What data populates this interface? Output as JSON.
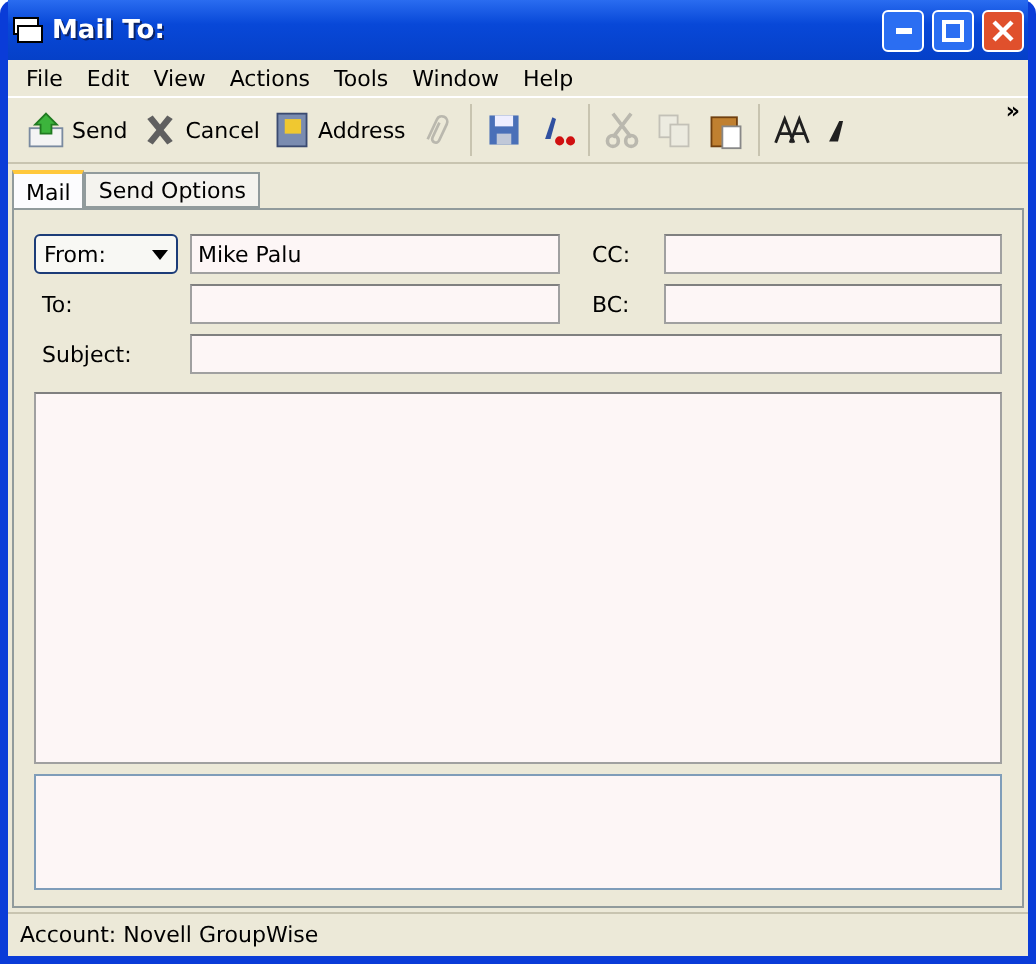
{
  "window": {
    "title": "Mail To:"
  },
  "menu": [
    "File",
    "Edit",
    "View",
    "Actions",
    "Tools",
    "Window",
    "Help"
  ],
  "toolbar": [
    {
      "kind": "send",
      "label": "Send",
      "disabled": false
    },
    {
      "kind": "cancel",
      "label": "Cancel",
      "disabled": false
    },
    {
      "kind": "address",
      "label": "Address",
      "disabled": false
    },
    {
      "kind": "attach",
      "disabled": true
    },
    {
      "kind": "separator"
    },
    {
      "kind": "save",
      "disabled": false
    },
    {
      "kind": "spell",
      "disabled": false
    },
    {
      "kind": "separator"
    },
    {
      "kind": "cut",
      "disabled": true
    },
    {
      "kind": "copy",
      "disabled": true
    },
    {
      "kind": "paste",
      "disabled": false
    },
    {
      "kind": "separator"
    },
    {
      "kind": "font",
      "disabled": false
    },
    {
      "kind": "italic",
      "disabled": false
    }
  ],
  "toolbar_overflow": "»",
  "tabs": [
    {
      "label": "Mail",
      "selected": true
    },
    {
      "label": "Send Options",
      "selected": false
    }
  ],
  "from": {
    "label": "From:",
    "value": "Mike Palu"
  },
  "to": {
    "label": "To:"
  },
  "cc": {
    "label": "CC:"
  },
  "bc": {
    "label": "BC:"
  },
  "subject": {
    "label": "Subject:"
  },
  "status_bar": "Account: Novell GroupWise"
}
